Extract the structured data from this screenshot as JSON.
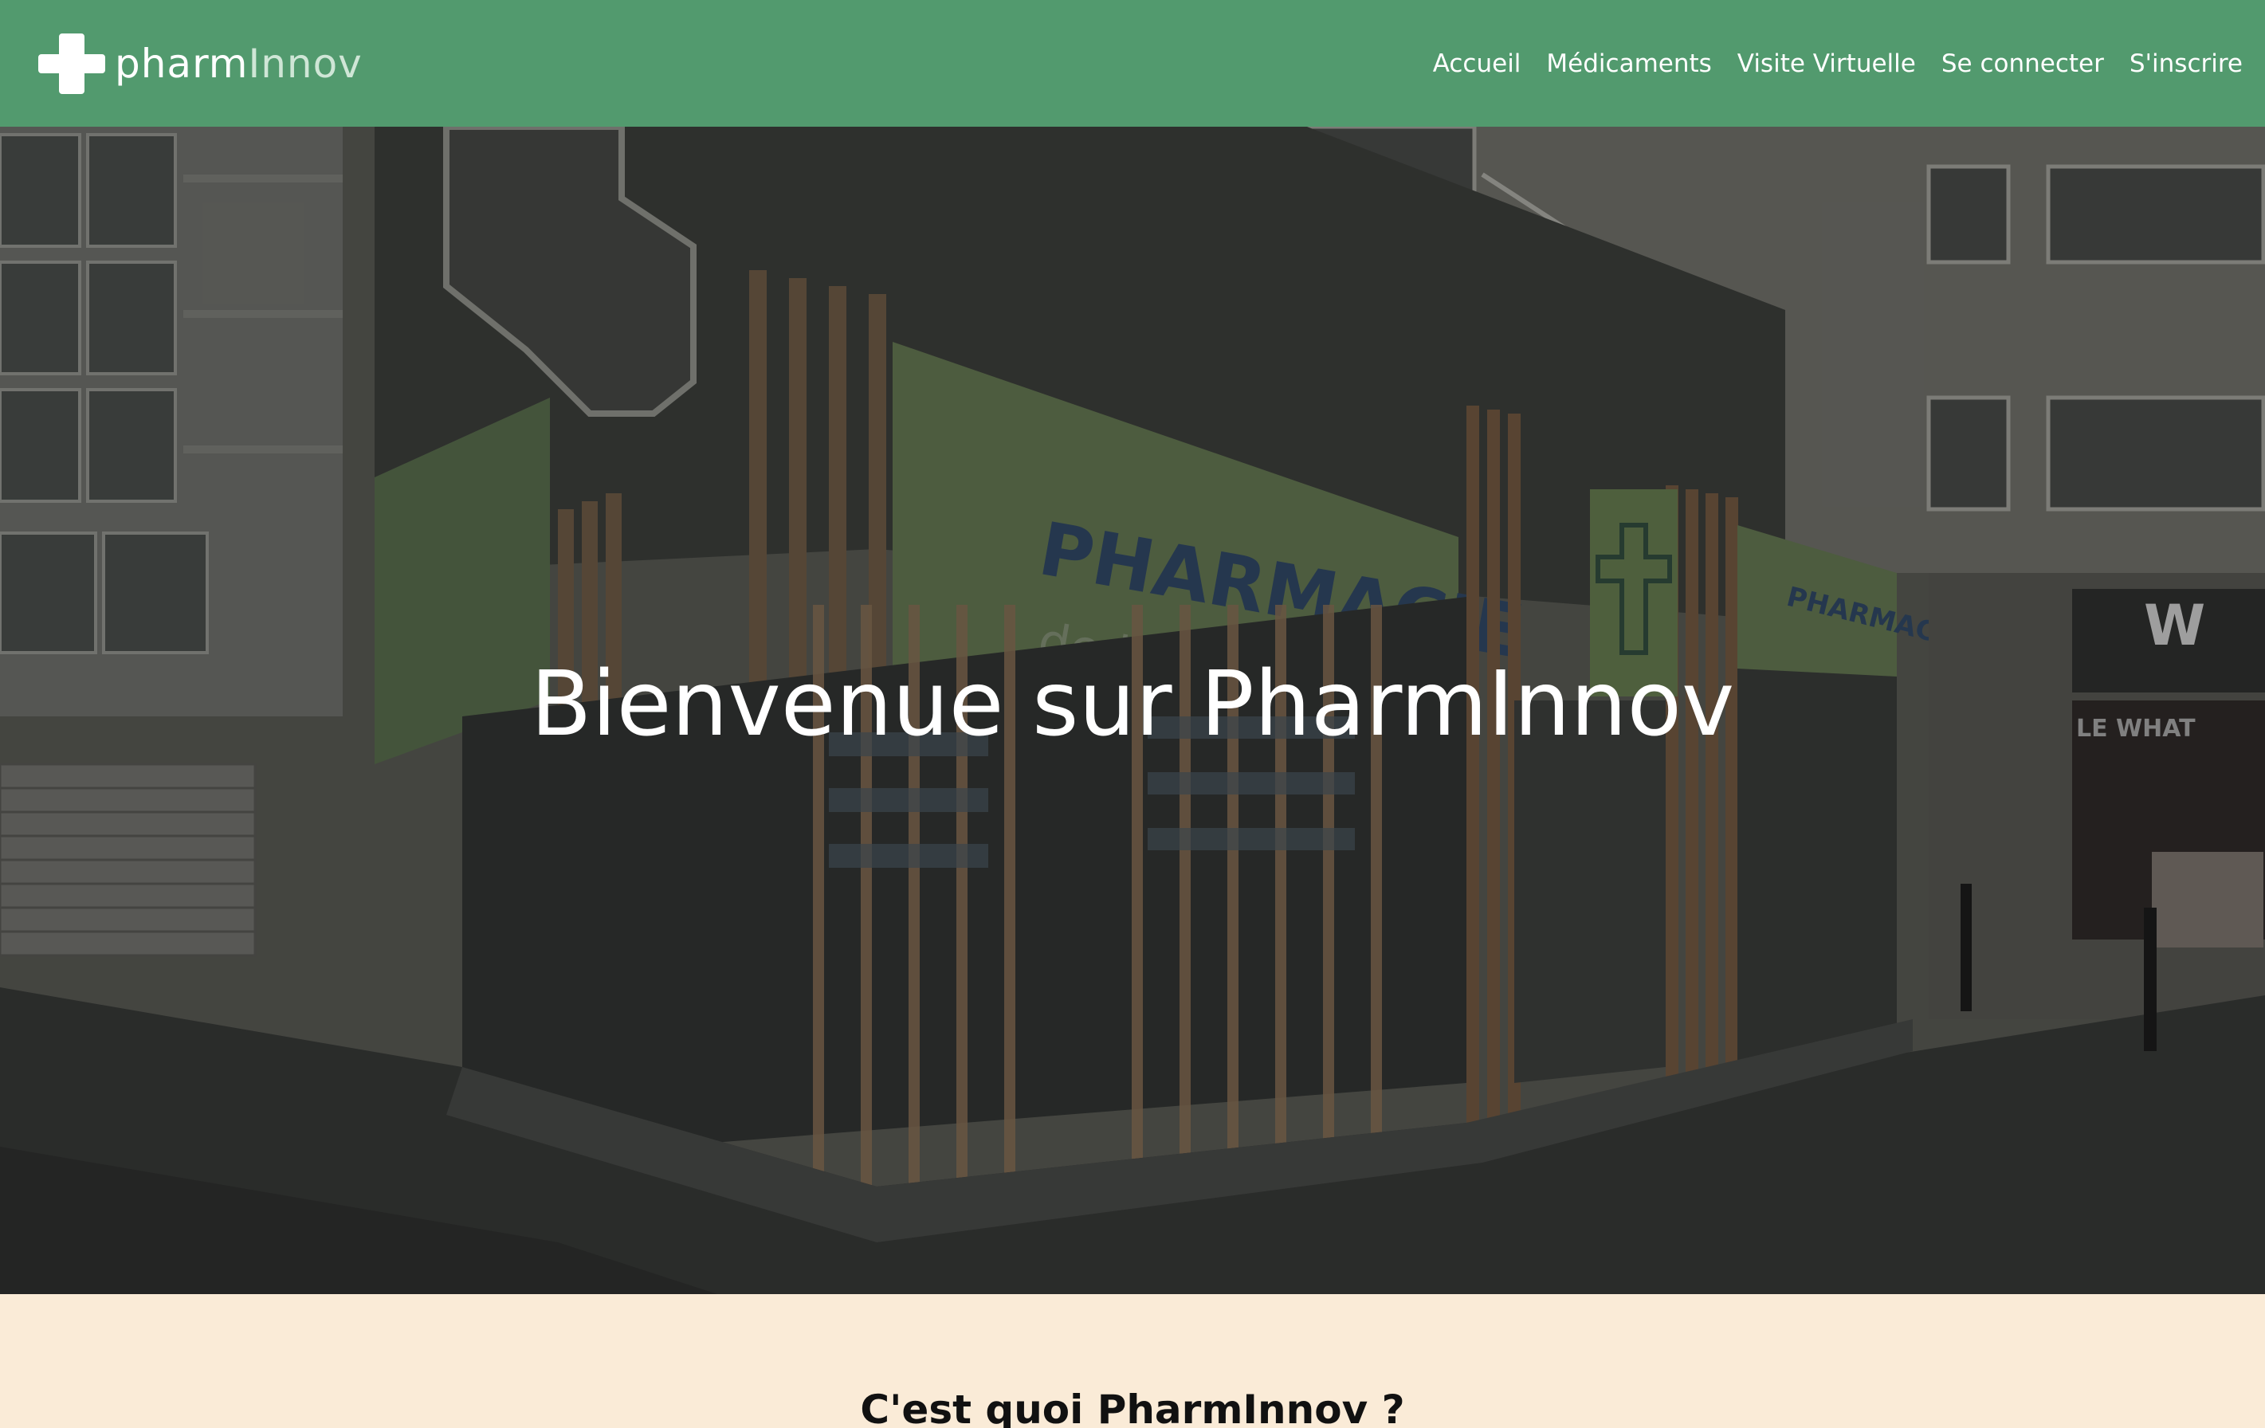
{
  "brand": {
    "name_part1": "pharm",
    "name_part2": "Innov",
    "icon": "pharmacy-cross-icon"
  },
  "nav": {
    "items": [
      {
        "label": "Accueil"
      },
      {
        "label": "Médicaments"
      },
      {
        "label": "Visite Virtuelle"
      },
      {
        "label": "Se connecter"
      },
      {
        "label": "S'inscrire"
      }
    ]
  },
  "hero": {
    "title": "Bienvenue sur PharmInnov",
    "sign_title": "PHARMACIE",
    "sign_subtitle": "de la Presqu'île",
    "small_sign_title": "PHARMACIE",
    "shop_sign": "LE WHAT"
  },
  "about": {
    "title": "C'est quoi PharmInnov ?"
  },
  "colors": {
    "navbar": "#529a6e",
    "section_bg": "#faebd7",
    "nav_text": "#ffffff"
  }
}
